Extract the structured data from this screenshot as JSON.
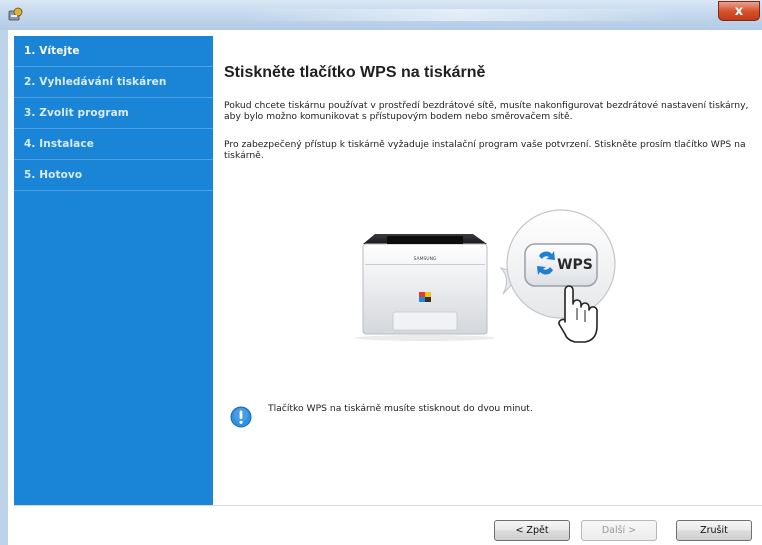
{
  "window": {
    "title": "",
    "close_label": "x"
  },
  "sidebar": {
    "items": [
      {
        "label": "1. Vítejte",
        "state": "active"
      },
      {
        "label": "2. Vyhledávání tiskáren",
        "state": "inactive"
      },
      {
        "label": "3. Zvolit program",
        "state": "inactive"
      },
      {
        "label": "4. Instalace",
        "state": "inactive"
      },
      {
        "label": "5. Hotovo",
        "state": "inactive"
      }
    ]
  },
  "main": {
    "heading": "Stiskněte tlačítko WPS na tiskárně",
    "paragraph1_line1": "Pokud chcete tiskárnu používat v prostředí bezdrátové sítě, musíte nakonfigurovat bezdrátové nastavení tiskárny,",
    "paragraph1_line2": "aby bylo možno komunikovat s přístupovým bodem nebo směrovačem sítě.",
    "paragraph2_line1": "Pro zabezpečený přístup k tiskárně vyžaduje instalační program vaše potvrzení. Stiskněte prosím tlačítko WPS na",
    "paragraph2_line2": "tiskárně.",
    "illustration": {
      "printer_brand": "SAMSUNG",
      "wps_label": "WPS"
    },
    "note": "Tlačítko WPS na tiskárně musíte stisknout do dvou minut."
  },
  "footer": {
    "back_label": "< Zpět",
    "next_label": "Další >",
    "cancel_label": "Zrušit"
  },
  "colors": {
    "sidebar": "#1a84d6",
    "titlebar": "#c4d8ee",
    "info_icon": "#2f8fe0",
    "close_button": "#d7532e"
  }
}
